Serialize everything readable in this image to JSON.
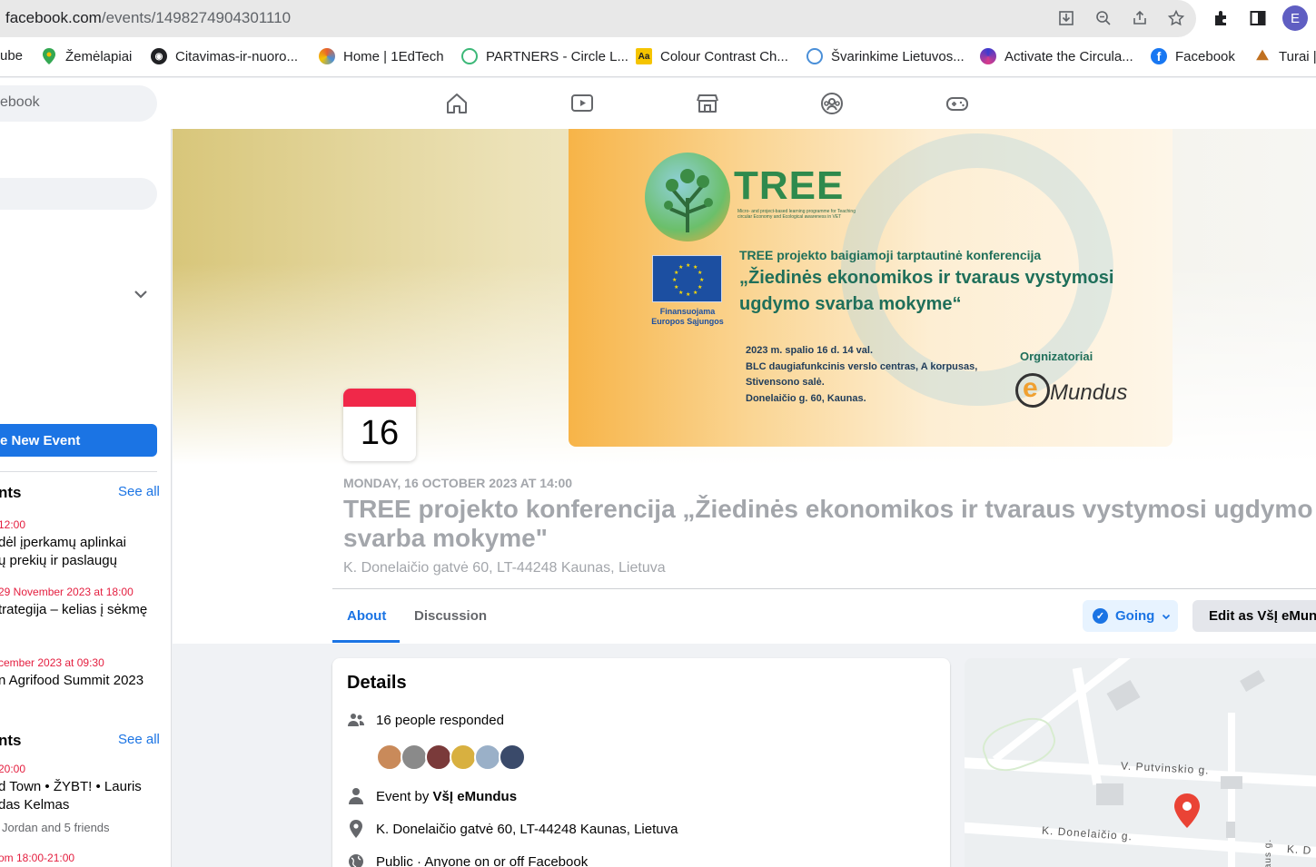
{
  "browser": {
    "url_host": "facebook.com",
    "url_path": "/events/1498274904301110",
    "profile_initial": "E"
  },
  "bookmarks": [
    {
      "label": "ube",
      "icon": "youtube-icon",
      "color": "#ff0000"
    },
    {
      "label": "Žemėlapiai",
      "icon": "maps-pin-icon",
      "color": "#34a853"
    },
    {
      "label": "Citavimas-ir-nuoro...",
      "icon": "globe-icon",
      "color": "#202124"
    },
    {
      "label": "Home | 1EdTech",
      "icon": "edtech-icon",
      "color": "#e8602c"
    },
    {
      "label": "PARTNERS - Circle L...",
      "icon": "circle-lab-icon",
      "color": "#3cb878"
    },
    {
      "label": "Colour Contrast Ch...",
      "icon": "aa-icon",
      "color": "#f5c400"
    },
    {
      "label": "Švarinkime Lietuvos...",
      "icon": "rings-icon",
      "color": "#4a8fd8"
    },
    {
      "label": "Activate the Circula...",
      "icon": "petals-icon",
      "color": "#3b3bd0"
    },
    {
      "label": "Facebook",
      "icon": "facebook-icon",
      "color": "#1877f2"
    },
    {
      "label": "Turai |",
      "icon": "hiker-icon",
      "color": "#c07020"
    }
  ],
  "fb_header": {
    "search_placeholder": "ebook"
  },
  "sidebar": {
    "create_button": "e New Event",
    "section1": {
      "title": "nts",
      "see_all": "See all",
      "events": [
        {
          "date": "12:00",
          "name_lines": [
            "dėl įperkamų aplinkai",
            "ų prekių ir paslaugų"
          ]
        },
        {
          "date": "29 November 2023 at 18:00",
          "name_lines": [
            "trategija – kelias į sėkmę"
          ]
        },
        {
          "date": "cember 2023 at 09:30",
          "name_lines": [
            "n Agrifood Summit 2023"
          ]
        }
      ]
    },
    "section2": {
      "title": "nts",
      "see_all": "See all",
      "events": [
        {
          "date": "20:00",
          "name_lines": [
            "d Town • ŽYBT! • Lauris",
            "das Kelmas"
          ],
          "meta": "Jordan and 5 friends"
        },
        {
          "date": "om 18:00-21:00",
          "name_lines": []
        }
      ]
    }
  },
  "banner": {
    "brand": "TREE",
    "brand_sub": "Micro- and project-based learning programme for Teaching circular Economy and Ecological awareness in VET",
    "eu_caption": "Finansuojama Europos Sąjungos",
    "line1": "TREE projekto baigiamoji tarptautinė konferencija",
    "title": "„Žiedinės ekonomikos ir tvaraus vystymosi ugdymo svarba mokyme“",
    "details": "2023 m. spalio 16 d. 14 val.\nBLC daugiafunkcinis verslo centras, A korpusas,\nStivensono salė.\nDonelaičio g. 60, Kaunas.",
    "organizer_label": "Orgnizatoriai",
    "organizer_e": "e",
    "organizer_name": "Mundus"
  },
  "event": {
    "calendar_day": "16",
    "datetime": "MONDAY, 16 OCTOBER 2023 AT 14:00",
    "title": "TREE projekto konferencija „Žiedinės ekonomikos ir tvaraus vystymosi ugdymo svarba mokyme\"",
    "address": "K. Donelaičio gatvė 60, LT-44248 Kaunas, Lietuva",
    "tabs": [
      "About",
      "Discussion"
    ],
    "going_label": "Going",
    "edit_label": "Edit as VšĮ eMundus"
  },
  "details": {
    "title": "Details",
    "responded": "16 people responded",
    "event_by_prefix": "Event by ",
    "event_by_name": "VšĮ eMundus",
    "address": "K. Donelaičio gatvė 60, LT-44248 Kaunas, Lietuva",
    "privacy": "Public · Anyone on or off Facebook",
    "avatar_colors": [
      "#c98a5a",
      "#8a8a8a",
      "#7a3a3a",
      "#d8b040",
      "#9ab0c8",
      "#3a4a6a"
    ]
  },
  "map": {
    "street1": "V. Putvinskio g.",
    "street2": "K. Donelaičio g.",
    "street3": "K. D",
    "street4": "aus g."
  }
}
